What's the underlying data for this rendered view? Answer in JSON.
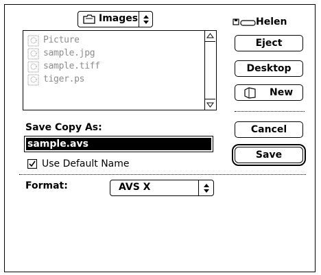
{
  "location_popup": {
    "label": "Images",
    "icon": "folder-icon"
  },
  "volume": {
    "icon": "disk-icon",
    "name": "Helen"
  },
  "files": [
    {
      "name": "Picture",
      "icon": "document-icon"
    },
    {
      "name": "sample.jpg",
      "icon": "document-icon"
    },
    {
      "name": "sample.tiff",
      "icon": "document-icon"
    },
    {
      "name": "tiger.ps",
      "icon": "document-icon"
    }
  ],
  "buttons": {
    "eject": "Eject",
    "desktop": "Desktop",
    "new": "New",
    "cancel": "Cancel",
    "save": "Save"
  },
  "save_as": {
    "label": "Save Copy As:",
    "value": "sample.avs"
  },
  "default_name": {
    "label": "Use Default Name",
    "checked": true
  },
  "format": {
    "label": "Format:",
    "value": "AVS X"
  }
}
